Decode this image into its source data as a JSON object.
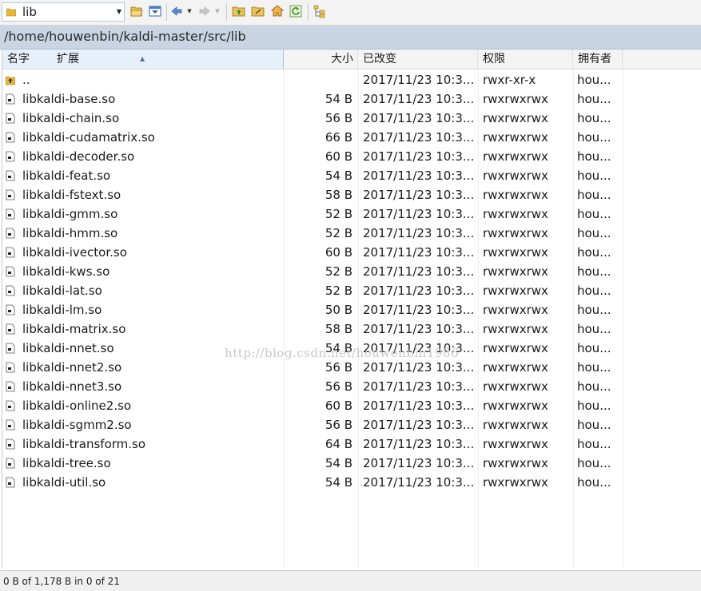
{
  "toolbar": {
    "directory": "lib",
    "buttons": [
      {
        "name": "open-folder-icon"
      },
      {
        "name": "filter-icon"
      },
      {
        "name": "back-arrow-icon"
      },
      {
        "name": "forward-arrow-icon"
      },
      {
        "name": "parent-folder-icon"
      },
      {
        "name": "root-folder-icon"
      },
      {
        "name": "home-icon"
      },
      {
        "name": "refresh-icon"
      },
      {
        "name": "tree-view-icon"
      }
    ]
  },
  "path": "/home/houwenbin/kaldi-master/src/lib",
  "columns": {
    "name": "名字",
    "ext": "扩展",
    "size": "大小",
    "changed": "已改变",
    "permissions": "权限",
    "owner": "拥有者"
  },
  "files": [
    {
      "name": "..",
      "size": "",
      "changed": "2017/11/23 10:3...",
      "permissions": "rwxr-xr-x",
      "owner": "hou...",
      "type": "parent"
    },
    {
      "name": "libkaldi-base.so",
      "size": "54 B",
      "changed": "2017/11/23 10:3...",
      "permissions": "rwxrwxrwx",
      "owner": "hou...",
      "type": "file"
    },
    {
      "name": "libkaldi-chain.so",
      "size": "56 B",
      "changed": "2017/11/23 10:3...",
      "permissions": "rwxrwxrwx",
      "owner": "hou...",
      "type": "file"
    },
    {
      "name": "libkaldi-cudamatrix.so",
      "size": "66 B",
      "changed": "2017/11/23 10:3...",
      "permissions": "rwxrwxrwx",
      "owner": "hou...",
      "type": "file"
    },
    {
      "name": "libkaldi-decoder.so",
      "size": "60 B",
      "changed": "2017/11/23 10:3...",
      "permissions": "rwxrwxrwx",
      "owner": "hou...",
      "type": "file"
    },
    {
      "name": "libkaldi-feat.so",
      "size": "54 B",
      "changed": "2017/11/23 10:3...",
      "permissions": "rwxrwxrwx",
      "owner": "hou...",
      "type": "file"
    },
    {
      "name": "libkaldi-fstext.so",
      "size": "58 B",
      "changed": "2017/11/23 10:3...",
      "permissions": "rwxrwxrwx",
      "owner": "hou...",
      "type": "file"
    },
    {
      "name": "libkaldi-gmm.so",
      "size": "52 B",
      "changed": "2017/11/23 10:3...",
      "permissions": "rwxrwxrwx",
      "owner": "hou...",
      "type": "file"
    },
    {
      "name": "libkaldi-hmm.so",
      "size": "52 B",
      "changed": "2017/11/23 10:3...",
      "permissions": "rwxrwxrwx",
      "owner": "hou...",
      "type": "file"
    },
    {
      "name": "libkaldi-ivector.so",
      "size": "60 B",
      "changed": "2017/11/23 10:3...",
      "permissions": "rwxrwxrwx",
      "owner": "hou...",
      "type": "file"
    },
    {
      "name": "libkaldi-kws.so",
      "size": "52 B",
      "changed": "2017/11/23 10:3...",
      "permissions": "rwxrwxrwx",
      "owner": "hou...",
      "type": "file"
    },
    {
      "name": "libkaldi-lat.so",
      "size": "52 B",
      "changed": "2017/11/23 10:3...",
      "permissions": "rwxrwxrwx",
      "owner": "hou...",
      "type": "file"
    },
    {
      "name": "libkaldi-lm.so",
      "size": "50 B",
      "changed": "2017/11/23 10:3...",
      "permissions": "rwxrwxrwx",
      "owner": "hou...",
      "type": "file"
    },
    {
      "name": "libkaldi-matrix.so",
      "size": "58 B",
      "changed": "2017/11/23 10:3...",
      "permissions": "rwxrwxrwx",
      "owner": "hou...",
      "type": "file"
    },
    {
      "name": "libkaldi-nnet.so",
      "size": "54 B",
      "changed": "2017/11/23 10:3...",
      "permissions": "rwxrwxrwx",
      "owner": "hou...",
      "type": "file"
    },
    {
      "name": "libkaldi-nnet2.so",
      "size": "56 B",
      "changed": "2017/11/23 10:3...",
      "permissions": "rwxrwxrwx",
      "owner": "hou...",
      "type": "file"
    },
    {
      "name": "libkaldi-nnet3.so",
      "size": "56 B",
      "changed": "2017/11/23 10:3...",
      "permissions": "rwxrwxrwx",
      "owner": "hou...",
      "type": "file"
    },
    {
      "name": "libkaldi-online2.so",
      "size": "60 B",
      "changed": "2017/11/23 10:3...",
      "permissions": "rwxrwxrwx",
      "owner": "hou...",
      "type": "file"
    },
    {
      "name": "libkaldi-sgmm2.so",
      "size": "56 B",
      "changed": "2017/11/23 10:3...",
      "permissions": "rwxrwxrwx",
      "owner": "hou...",
      "type": "file"
    },
    {
      "name": "libkaldi-transform.so",
      "size": "64 B",
      "changed": "2017/11/23 10:3...",
      "permissions": "rwxrwxrwx",
      "owner": "hou...",
      "type": "file"
    },
    {
      "name": "libkaldi-tree.so",
      "size": "54 B",
      "changed": "2017/11/23 10:3...",
      "permissions": "rwxrwxrwx",
      "owner": "hou...",
      "type": "file"
    },
    {
      "name": "libkaldi-util.so",
      "size": "54 B",
      "changed": "2017/11/23 10:3...",
      "permissions": "rwxrwxrwx",
      "owner": "hou...",
      "type": "file"
    }
  ],
  "watermark": "http://blog.csdn.net/houwenbin1986",
  "status": "0 B of 1,178 B in 0 of 21",
  "colors": {
    "pathbar": "#c9d5e2",
    "folder": "#e8b737",
    "header_active": "#e6f0fa"
  }
}
